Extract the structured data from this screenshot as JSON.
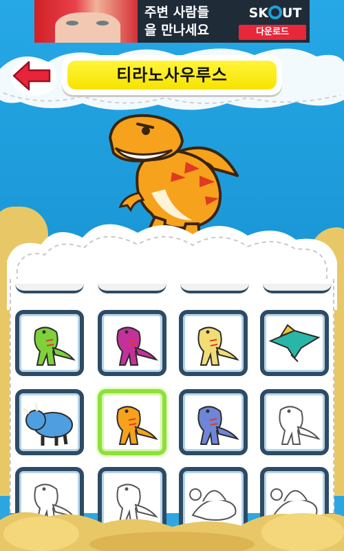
{
  "ad": {
    "line1": "주변 사람들",
    "line2": "을 만나세요",
    "brand_left": "SK",
    "brand_right": "UT",
    "download": "다운로드"
  },
  "header": {
    "title": "티라노사우루스",
    "back_icon": "red-arrow-left-icon"
  },
  "hero": {
    "species": "tyrannosaurus",
    "color": "#f6a21c"
  },
  "grid": {
    "selected_index": 5,
    "tiles": [
      {
        "species": "green-raptor",
        "color": "#7fd13b",
        "style": "color"
      },
      {
        "species": "purple-allosaurus",
        "color": "#c3319a",
        "style": "color"
      },
      {
        "species": "parasaurolophus",
        "color": "#f2dc74",
        "style": "color"
      },
      {
        "species": "pteranodon",
        "color": "#29b6a8",
        "style": "color"
      },
      {
        "species": "triceratops",
        "color": "#4f9fe0",
        "style": "color"
      },
      {
        "species": "tyrannosaurus",
        "color": "#f6a21c",
        "style": "color"
      },
      {
        "species": "blue-hadrosaur",
        "color": "#6f86d8",
        "style": "color"
      },
      {
        "species": "raptor-outline",
        "color": "#ffffff",
        "style": "outline"
      },
      {
        "species": "outline-dino-1",
        "color": "#ffffff",
        "style": "outline"
      },
      {
        "species": "outline-dino-2",
        "color": "#ffffff",
        "style": "outline"
      },
      {
        "species": "spinosaurus-outline",
        "color": "#ffffff",
        "style": "outline"
      },
      {
        "species": "longneck-outline",
        "color": "#ffffff",
        "style": "outline"
      }
    ]
  },
  "colors": {
    "sky": "#1f9fdc",
    "title_yellow": "#f6e300",
    "tile_border": "#2d4b64",
    "selected_border": "#8ee03c",
    "back_arrow": "#e8233a"
  }
}
